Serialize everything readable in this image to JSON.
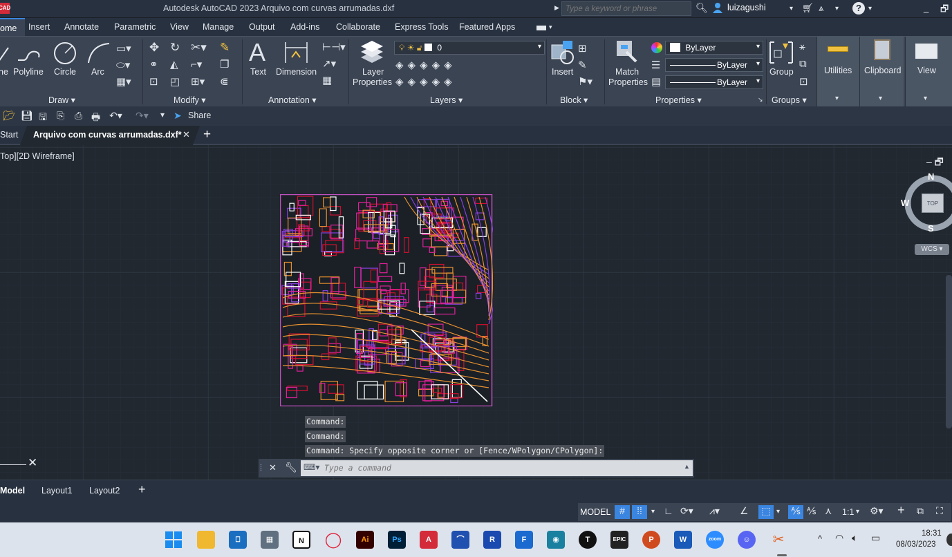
{
  "titlebar": {
    "title": "Autodesk AutoCAD 2023    Arquivo com curvas arrumadas.dxf",
    "search_placeholder": "Type a keyword or phrase",
    "user": "luizagushi",
    "logo": "CAD"
  },
  "ribbon_tabs": [
    "ome",
    "Insert",
    "Annotate",
    "Parametric",
    "View",
    "Manage",
    "Output",
    "Add-ins",
    "Collaborate",
    "Express Tools",
    "Featured Apps"
  ],
  "ribbon": {
    "draw": {
      "polyline": "Polyline",
      "circle": "Circle",
      "arc": "Arc",
      "line_partial": "ne",
      "panel": "Draw ▾"
    },
    "modify": {
      "panel": "Modify ▾"
    },
    "annotation": {
      "text": "Text",
      "dimension": "Dimension",
      "panel": "Annotation ▾"
    },
    "layers": {
      "layer_properties_1": "Layer",
      "layer_properties_2": "Properties",
      "current_layer": "0",
      "panel": "Layers ▾"
    },
    "block": {
      "insert": "Insert",
      "panel": "Block ▾"
    },
    "properties": {
      "match_1": "Match",
      "match_2": "Properties",
      "color": "ByLayer",
      "linetype": "ByLayer",
      "lineweight": "ByLayer",
      "panel": "Properties ▾"
    },
    "groups": {
      "group": "Group",
      "panel": "Groups ▾"
    },
    "utilities": "Utilities",
    "clipboard": "Clipboard",
    "view": "View"
  },
  "qat": {
    "share": "Share"
  },
  "doc_tabs": {
    "start": "Start",
    "file": "Arquivo com curvas arrumadas.dxf*"
  },
  "viewport": {
    "label": "Top][2D Wireframe]",
    "viewcube": {
      "n": "N",
      "s": "S",
      "w": "W",
      "top": "TOP",
      "wcs": "WCS"
    }
  },
  "command": {
    "history": [
      "Command:",
      "Command:",
      "Command: Specify opposite corner or [Fence/WPolygon/CPolygon]:"
    ],
    "placeholder": "Type a command"
  },
  "layout_tabs": [
    "Model",
    "Layout1",
    "Layout2"
  ],
  "status": {
    "model": "MODEL",
    "scale": "1:1"
  },
  "taskbar": {
    "time": "18:31",
    "date": "08/03/2023"
  },
  "colors": {
    "accent": "#3a85e0",
    "autocad_red": "#d42b3a",
    "drawing_pink": "#e0209a",
    "drawing_red": "#d01030",
    "drawing_orange": "#e89030",
    "drawing_purple": "#8a40e0"
  }
}
